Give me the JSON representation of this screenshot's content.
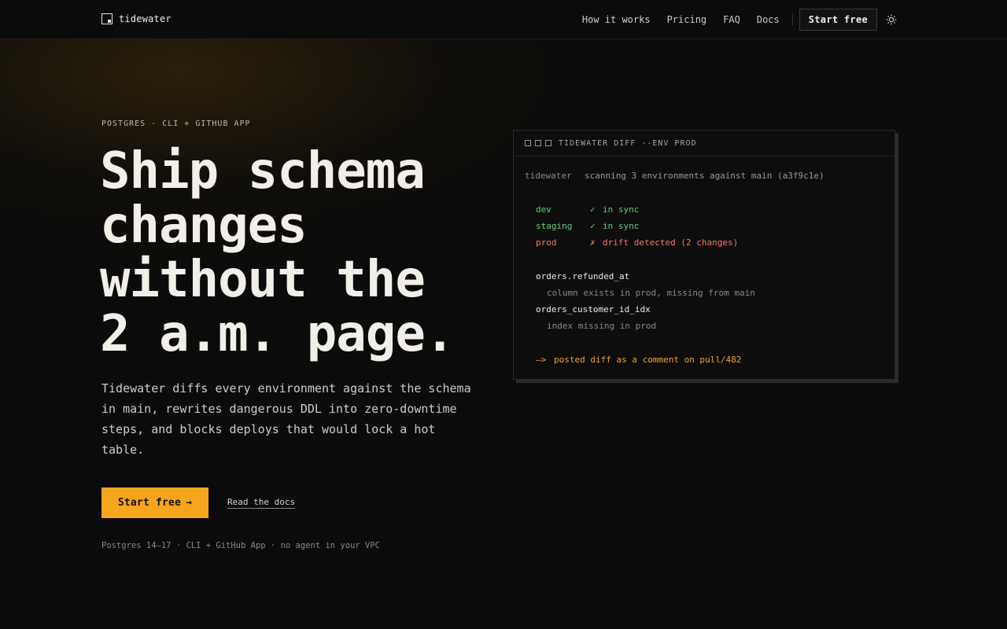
{
  "header": {
    "brand": "tidewater",
    "nav": [
      "How it works",
      "Pricing",
      "FAQ",
      "Docs"
    ],
    "cta": "Start free"
  },
  "hero": {
    "eyebrow": "POSTGRES · CLI + GITHUB APP",
    "headline": [
      "Ship schema",
      "changes",
      "without the",
      "2 a.m. page."
    ],
    "lede": "Tidewater diffs every environment against the schema in main, rewrites dangerous DDL into zero-downtime steps, and blocks deploys that would lock a hot table.",
    "primary_cta": "Start free",
    "primary_cta_arrow": "→",
    "secondary_cta": "Read the docs",
    "footnote": "Postgres 14–17 · CLI + GitHub App · no agent in your VPC"
  },
  "terminal": {
    "title": "TIDEWATER DIFF --ENV PROD",
    "scan_label": "tidewater",
    "scan_text": "scanning 3 environments against main (a3f9c1e)",
    "envs": [
      {
        "name": "dev",
        "mark": "✓",
        "status": "in sync"
      },
      {
        "name": "staging",
        "mark": "✓",
        "status": "in sync"
      },
      {
        "name": "prod",
        "mark": "✗",
        "status": "drift detected (2 changes)"
      }
    ],
    "changes": [
      {
        "object": "orders.refunded_at",
        "detail": "column exists in prod, missing from main"
      },
      {
        "object": "orders_customer_id_idx",
        "detail": "index missing in prod"
      }
    ],
    "footer_arrow": "—>",
    "footer_text": "posted diff as a comment on pull/482"
  },
  "colors": {
    "accent": "#f6a51c",
    "ok": "#5fcf73",
    "error": "#ef7c64",
    "background": "#0b0b0b"
  },
  "icons": {
    "theme_toggle": "sun-icon",
    "brand": "square-logo-icon"
  }
}
